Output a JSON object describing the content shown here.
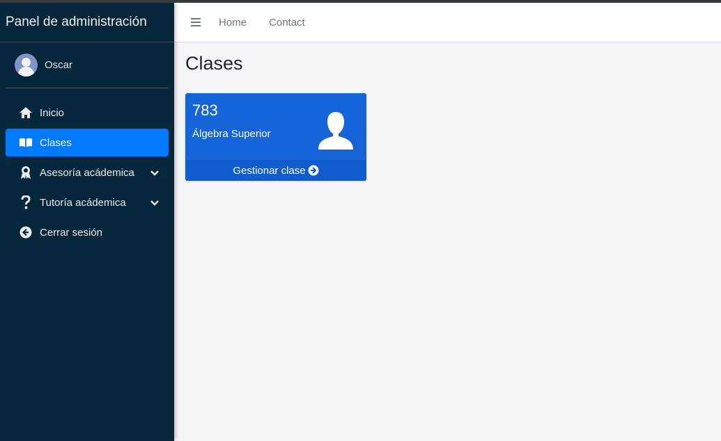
{
  "sidebar": {
    "brand": "Panel de administración",
    "user": {
      "name": "Oscar"
    },
    "items": [
      {
        "label": "Inicio",
        "icon": "home-icon",
        "active": false
      },
      {
        "label": "Clases",
        "icon": "book-open-icon",
        "active": true
      },
      {
        "label": "Asesoría acádemica",
        "icon": "award-icon",
        "active": false,
        "has_submenu": true
      },
      {
        "label": "Tutoría acádemica",
        "icon": "question-icon",
        "active": false,
        "has_submenu": true
      },
      {
        "label": "Cerrar sesión",
        "icon": "arrow-circle-left-icon",
        "active": false
      }
    ]
  },
  "header": {
    "links": [
      "Home",
      "Contact"
    ]
  },
  "main": {
    "title": "Clases",
    "card": {
      "number": "783",
      "text": "Álgebra Superior",
      "footer": "Gestionar clase",
      "icon": "user-icon",
      "color": "#1565d8"
    }
  },
  "colors": {
    "sidebar_bg": "#06263c",
    "active_item": "#007bff",
    "content_bg": "#f4f6f9"
  }
}
